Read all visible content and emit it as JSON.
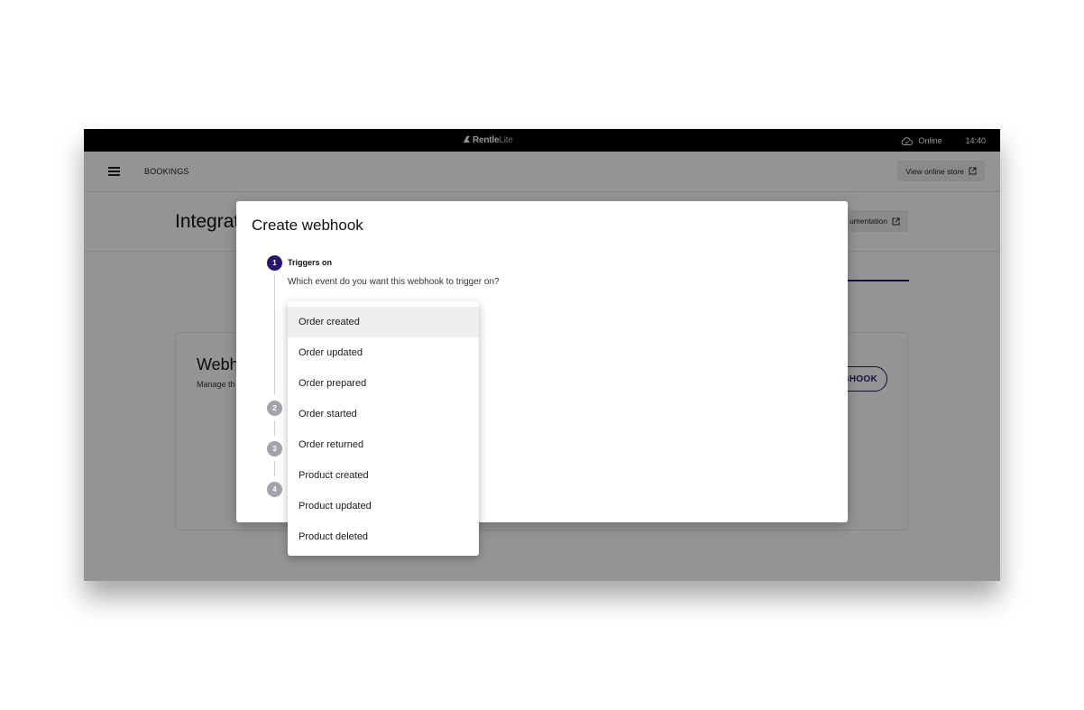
{
  "topbar": {
    "brand_main": "Rentle",
    "brand_suffix": "Lite",
    "status": "Online",
    "time": "14:40"
  },
  "header": {
    "nav_label": "BOOKINGS",
    "view_store_label": "View online store"
  },
  "page": {
    "title": "Integrat",
    "docs_button_label": "umentation"
  },
  "card": {
    "title": "Webh",
    "subtitle": "Manage th",
    "button_label": "BHOOK"
  },
  "modal": {
    "title": "Create webhook",
    "steps": [
      {
        "number": "1",
        "label": "Triggers on",
        "question": "Which event do you want this webhook to trigger on?"
      },
      {
        "number": "2"
      },
      {
        "number": "3"
      },
      {
        "number": "4"
      }
    ]
  },
  "dropdown": {
    "selected": "Order created",
    "options": [
      "Order created",
      "Order updated",
      "Order prepared",
      "Order started",
      "Order returned",
      "Product created",
      "Product updated",
      "Product deleted"
    ]
  },
  "colors": {
    "accent": "#2a1570",
    "step_inactive": "#a3a3ad",
    "scrim": "rgba(0,0,0,0.42)"
  }
}
